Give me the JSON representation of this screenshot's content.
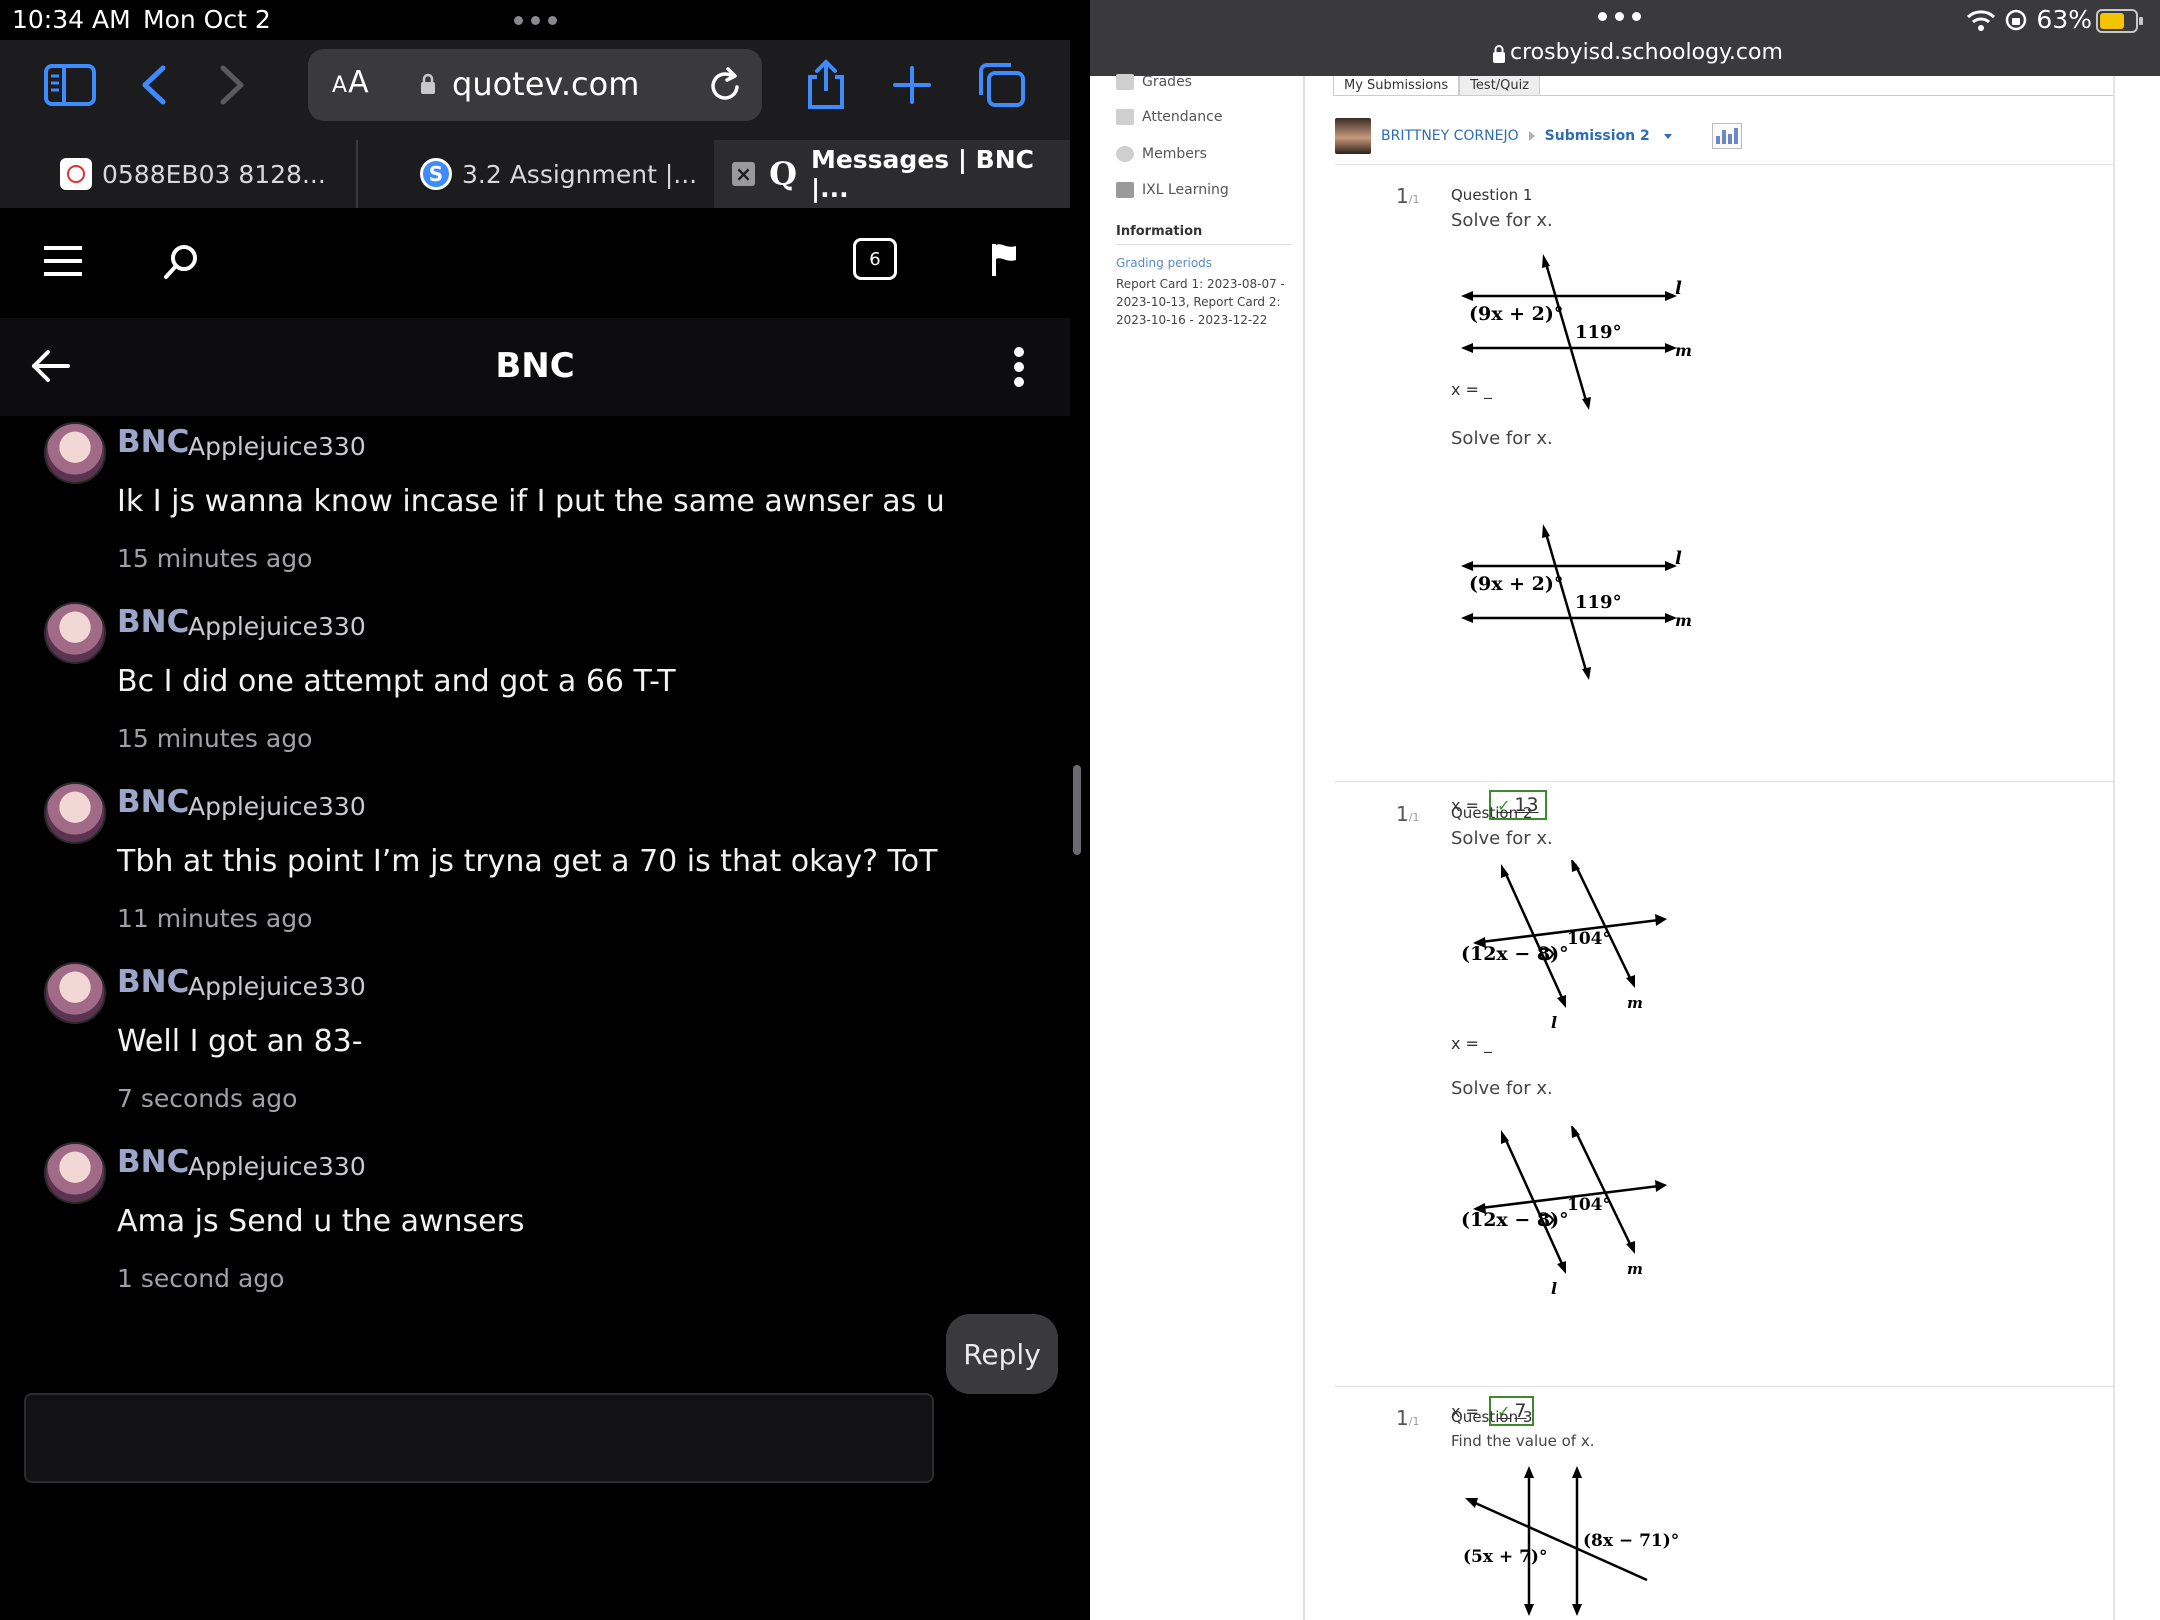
{
  "status": {
    "time": "10:34 AM",
    "date": "Mon Oct 2",
    "battery": "63%"
  },
  "left": {
    "address": {
      "aa": "AA",
      "url": "quotev.com"
    },
    "tabs": [
      {
        "label": "0588EB03 8128..."
      },
      {
        "label": "3.2 Assignment |..."
      },
      {
        "label": "Messages | BNC |..."
      }
    ],
    "header": {
      "notification_count": "6"
    },
    "conversation": {
      "title": "BNC"
    },
    "messages": [
      {
        "name": "BNC",
        "user": "Applejuice330",
        "text": "Ik I js wanna know incase if I put the same awnser as u",
        "ago": "15 minutes ago"
      },
      {
        "name": "BNC",
        "user": "Applejuice330",
        "text": "Bc I did one attempt and got a 66 T-T",
        "ago": "15 minutes ago"
      },
      {
        "name": "BNC",
        "user": "Applejuice330",
        "text": "Tbh at this point I’m js tryna get a 70 is that okay? ToT",
        "ago": "11 minutes ago"
      },
      {
        "name": "BNC",
        "user": "Applejuice330",
        "text": "Well I got an 83-",
        "ago": "7 seconds ago"
      },
      {
        "name": "BNC",
        "user": "Applejuice330",
        "text": "Ama js Send u the awnsers",
        "ago": "1 second ago"
      }
    ],
    "reply_label": "Reply"
  },
  "right": {
    "url": "crosbyisd.schoology.com",
    "sidebar": {
      "items": [
        "Grades",
        "Attendance",
        "Members",
        "IXL Learning"
      ],
      "info_heading": "Information",
      "grading_link": "Grading periods",
      "grading_text": "Report Card 1: 2023-08-07 - 2023-10-13, Report Card 2: 2023-10-16 - 2023-12-22"
    },
    "sub_tabs": [
      "My Submissions",
      "Test/Quiz"
    ],
    "student": {
      "name": "BRITTNEY CORNEJO",
      "submission": "Submission 2"
    },
    "questions": [
      {
        "score": "1",
        "of": "/1",
        "label": "Question 1",
        "prompt": "Solve for x.",
        "blank": "x = _",
        "prompt2": "Solve for x.",
        "answer_prefix": "x =",
        "answer": "13",
        "diagram": {
          "angle1": "(9x + 2)°",
          "angle2": "119°",
          "line1": "l",
          "line2": "m"
        }
      },
      {
        "score": "1",
        "of": "/1",
        "label": "Question 2",
        "prompt": "Solve for x.",
        "blank": "x = _",
        "prompt2": "Solve for x.",
        "answer_prefix": "x =",
        "answer": "7",
        "diagram": {
          "angle1": "(12x − 8)°",
          "angle2": "104°",
          "line1": "l",
          "line2": "m"
        }
      },
      {
        "score": "1",
        "of": "/1",
        "label": "Question 3",
        "prompt": "Find the value of x.",
        "diagram": {
          "angle1": "(5x + 7)°",
          "angle2": "(8x − 71)°"
        }
      }
    ]
  }
}
